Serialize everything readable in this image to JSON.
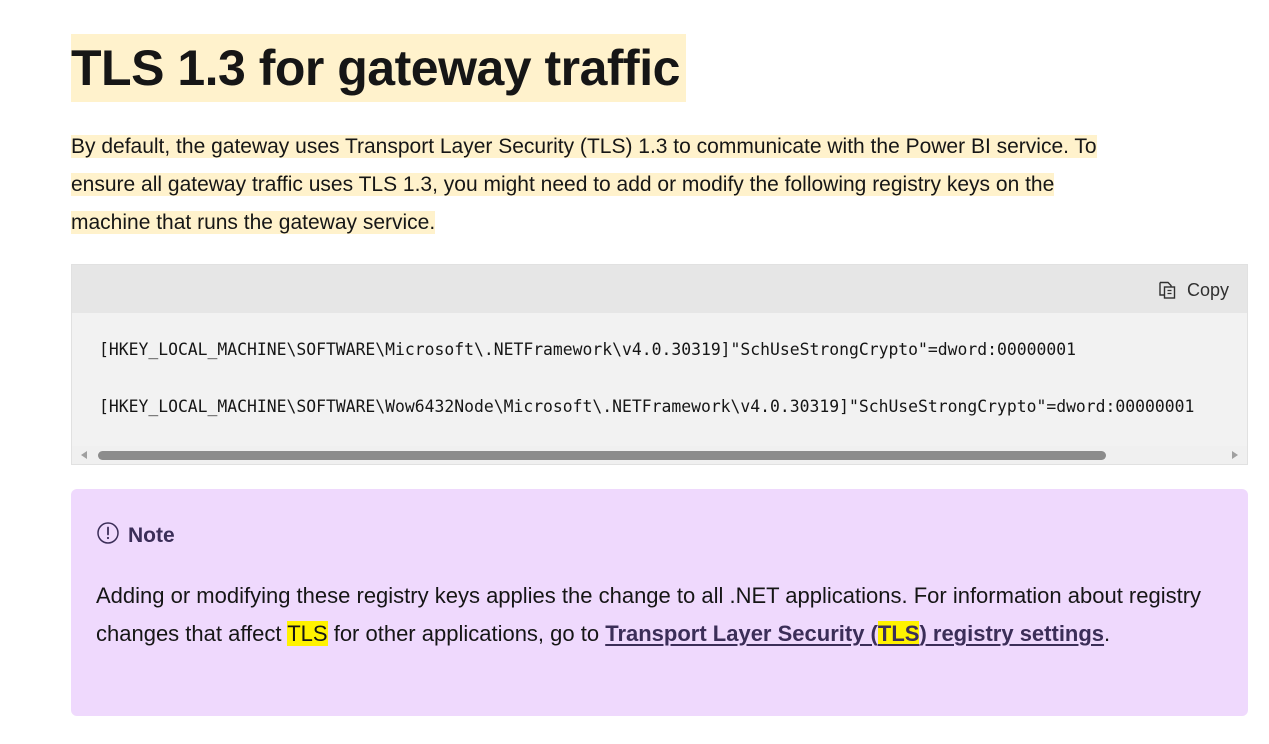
{
  "heading": "TLS 1.3 for gateway traffic",
  "intro": {
    "line1_a": "By default, the gateway uses Transport Layer Security (",
    "line1_tls": "TLS",
    "line1_b": ") 1.3 to communicate with the Power BI service. To",
    "line2_a": "ensure all gateway traffic uses ",
    "line2_tls": "TLS",
    "line2_b": " 1.3, you might need to add or modify the following registry keys on the",
    "line3": "machine that runs the gateway service."
  },
  "code": {
    "copy_label": "Copy",
    "copy_icon": "copy-icon",
    "lines": [
      "[HKEY_LOCAL_MACHINE\\SOFTWARE\\Microsoft\\.NETFramework\\v4.0.30319]\"SchUseStrongCrypto\"=dword:00000001",
      "[HKEY_LOCAL_MACHINE\\SOFTWARE\\Wow6432Node\\Microsoft\\.NETFramework\\v4.0.30319]\"SchUseStrongCrypto\"=dword:00000001"
    ]
  },
  "note": {
    "icon": "info-circle-icon",
    "title": "Note",
    "text_a": "Adding or modifying these registry keys applies the change to all .NET applications. For information about registry changes that affect ",
    "text_tls": "TLS",
    "text_b": " for other applications, go to ",
    "link_a": "Transport Layer Security (",
    "link_tls": "TLS",
    "link_b": ") registry settings",
    "text_end": "."
  },
  "colors": {
    "search_highlight": "#fff2cc",
    "match_highlight": "#fff200",
    "note_background": "#efd9fd",
    "note_accent": "#3b2e58",
    "code_background": "#f2f2f2"
  }
}
